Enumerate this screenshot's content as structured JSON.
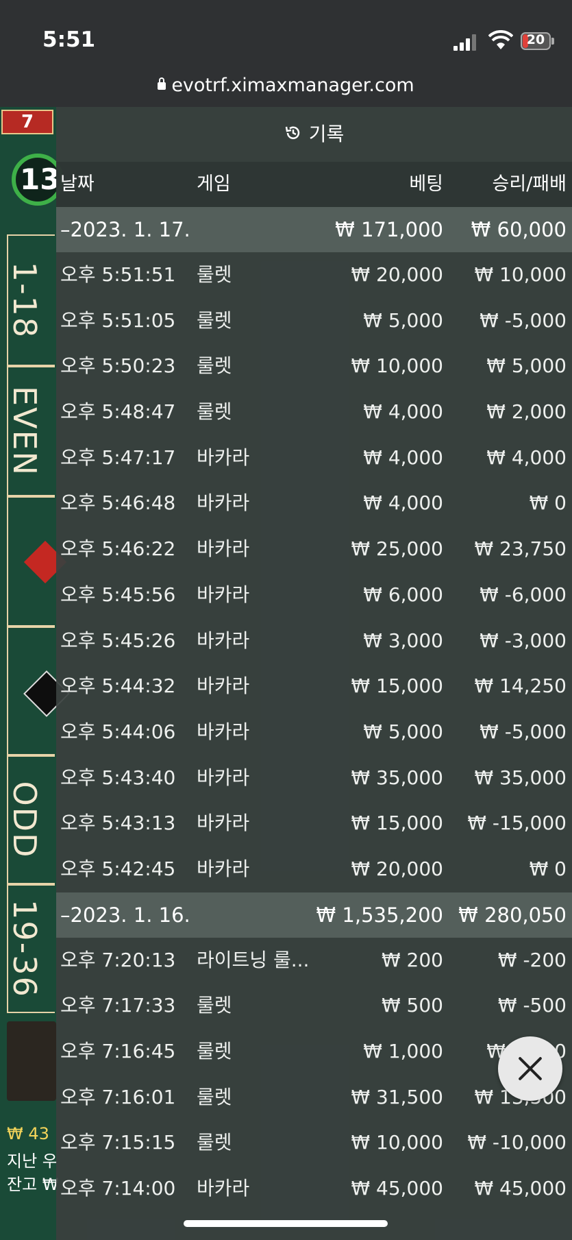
{
  "status": {
    "time": "5:51",
    "battery": "20"
  },
  "browser": {
    "url": "evotrf.ximaxmanager.com"
  },
  "background": {
    "number": "7",
    "timer": "13",
    "bets": [
      "1-18",
      "EVEN",
      "ODD",
      "19-36"
    ],
    "balance_line1": "₩ 43",
    "balance_line2": "지난 우",
    "balance_line3": "잔고 ₩"
  },
  "panel": {
    "title": "기록",
    "columns": {
      "date": "날짜",
      "game": "게임",
      "bet": "베팅",
      "result": "승리/패배"
    },
    "groups": [
      {
        "date": "–2023. 1. 17.",
        "bet": "₩ 171,000",
        "result": "₩ 60,000",
        "rows": [
          {
            "time": "오후 5:51:51",
            "game": "룰렛",
            "bet": "₩ 20,000",
            "result": "₩ 10,000"
          },
          {
            "time": "오후 5:51:05",
            "game": "룰렛",
            "bet": "₩ 5,000",
            "result": "₩ -5,000"
          },
          {
            "time": "오후 5:50:23",
            "game": "룰렛",
            "bet": "₩ 10,000",
            "result": "₩ 5,000"
          },
          {
            "time": "오후 5:48:47",
            "game": "룰렛",
            "bet": "₩ 4,000",
            "result": "₩ 2,000"
          },
          {
            "time": "오후 5:47:17",
            "game": "바카라",
            "bet": "₩ 4,000",
            "result": "₩ 4,000"
          },
          {
            "time": "오후 5:46:48",
            "game": "바카라",
            "bet": "₩ 4,000",
            "result": "₩ 0"
          },
          {
            "time": "오후 5:46:22",
            "game": "바카라",
            "bet": "₩ 25,000",
            "result": "₩ 23,750"
          },
          {
            "time": "오후 5:45:56",
            "game": "바카라",
            "bet": "₩ 6,000",
            "result": "₩ -6,000"
          },
          {
            "time": "오후 5:45:26",
            "game": "바카라",
            "bet": "₩ 3,000",
            "result": "₩ -3,000"
          },
          {
            "time": "오후 5:44:32",
            "game": "바카라",
            "bet": "₩ 15,000",
            "result": "₩ 14,250"
          },
          {
            "time": "오후 5:44:06",
            "game": "바카라",
            "bet": "₩ 5,000",
            "result": "₩ -5,000"
          },
          {
            "time": "오후 5:43:40",
            "game": "바카라",
            "bet": "₩ 35,000",
            "result": "₩ 35,000"
          },
          {
            "time": "오후 5:43:13",
            "game": "바카라",
            "bet": "₩ 15,000",
            "result": "₩ -15,000"
          },
          {
            "time": "오후 5:42:45",
            "game": "바카라",
            "bet": "₩ 20,000",
            "result": "₩ 0"
          }
        ]
      },
      {
        "date": "–2023. 1. 16.",
        "bet": "₩ 1,535,200",
        "result": "₩ 280,050",
        "rows": [
          {
            "time": "오후 7:20:13",
            "game": "라이트닝 룰...",
            "bet": "₩ 200",
            "result": "₩ -200"
          },
          {
            "time": "오후 7:17:33",
            "game": "룰렛",
            "bet": "₩ 500",
            "result": "₩ -500"
          },
          {
            "time": "오후 7:16:45",
            "game": "룰렛",
            "bet": "₩ 1,000",
            "result": "₩ 2,000"
          },
          {
            "time": "오후 7:16:01",
            "game": "룰렛",
            "bet": "₩ 31,500",
            "result": "₩ 13,500"
          },
          {
            "time": "오후 7:15:15",
            "game": "룰렛",
            "bet": "₩ 10,000",
            "result": "₩ -10,000"
          },
          {
            "time": "오후 7:14:00",
            "game": "바카라",
            "bet": "₩ 45,000",
            "result": "₩ 45,000"
          }
        ]
      }
    ]
  }
}
